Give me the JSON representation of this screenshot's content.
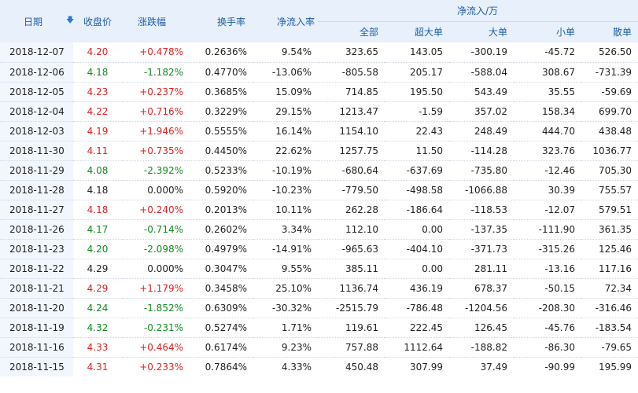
{
  "header": {
    "date": "日期",
    "close": "收盘价",
    "change": "涨跌幅",
    "turnover": "换手率",
    "net_rate": "净流入率",
    "group": "净流入/万",
    "all": "全部",
    "xl": "超大单",
    "l": "大单",
    "s": "小单",
    "r": "散单",
    "sort_icon": "arrow-down-icon"
  },
  "colors": {
    "up": "#e02222",
    "down": "#138a1f",
    "header_text": "#1f5ea8",
    "header_bg": "#e7f0fb"
  },
  "rows": [
    {
      "date": "2018-12-07",
      "close": "4.20",
      "change": "+0.478%",
      "turnover": "0.2636%",
      "rate": "9.54%",
      "all": "323.65",
      "xl": "143.05",
      "l": "-300.19",
      "s": "-45.72",
      "r": "526.50",
      "dir": "up"
    },
    {
      "date": "2018-12-06",
      "close": "4.18",
      "change": "-1.182%",
      "turnover": "0.4770%",
      "rate": "-13.06%",
      "all": "-805.58",
      "xl": "205.17",
      "l": "-588.04",
      "s": "308.67",
      "r": "-731.39",
      "dir": "down"
    },
    {
      "date": "2018-12-05",
      "close": "4.23",
      "change": "+0.237%",
      "turnover": "0.3685%",
      "rate": "15.09%",
      "all": "714.85",
      "xl": "195.50",
      "l": "543.49",
      "s": "35.55",
      "r": "-59.69",
      "dir": "up"
    },
    {
      "date": "2018-12-04",
      "close": "4.22",
      "change": "+0.716%",
      "turnover": "0.3229%",
      "rate": "29.15%",
      "all": "1213.47",
      "xl": "-1.59",
      "l": "357.02",
      "s": "158.34",
      "r": "699.70",
      "dir": "up"
    },
    {
      "date": "2018-12-03",
      "close": "4.19",
      "change": "+1.946%",
      "turnover": "0.5555%",
      "rate": "16.14%",
      "all": "1154.10",
      "xl": "22.43",
      "l": "248.49",
      "s": "444.70",
      "r": "438.48",
      "dir": "up"
    },
    {
      "date": "2018-11-30",
      "close": "4.11",
      "change": "+0.735%",
      "turnover": "0.4450%",
      "rate": "22.62%",
      "all": "1257.75",
      "xl": "11.50",
      "l": "-114.28",
      "s": "323.76",
      "r": "1036.77",
      "dir": "up"
    },
    {
      "date": "2018-11-29",
      "close": "4.08",
      "change": "-2.392%",
      "turnover": "0.5233%",
      "rate": "-10.19%",
      "all": "-680.64",
      "xl": "-637.69",
      "l": "-735.80",
      "s": "-12.46",
      "r": "705.30",
      "dir": "down"
    },
    {
      "date": "2018-11-28",
      "close": "4.18",
      "change": "0.000%",
      "turnover": "0.5920%",
      "rate": "-10.23%",
      "all": "-779.50",
      "xl": "-498.58",
      "l": "-1066.88",
      "s": "30.39",
      "r": "755.57",
      "dir": "flat"
    },
    {
      "date": "2018-11-27",
      "close": "4.18",
      "change": "+0.240%",
      "turnover": "0.2013%",
      "rate": "10.11%",
      "all": "262.28",
      "xl": "-186.64",
      "l": "-118.53",
      "s": "-12.07",
      "r": "579.51",
      "dir": "up"
    },
    {
      "date": "2018-11-26",
      "close": "4.17",
      "change": "-0.714%",
      "turnover": "0.2602%",
      "rate": "3.34%",
      "all": "112.10",
      "xl": "0.00",
      "l": "-137.35",
      "s": "-111.90",
      "r": "361.35",
      "dir": "down"
    },
    {
      "date": "2018-11-23",
      "close": "4.20",
      "change": "-2.098%",
      "turnover": "0.4979%",
      "rate": "-14.91%",
      "all": "-965.63",
      "xl": "-404.10",
      "l": "-371.73",
      "s": "-315.26",
      "r": "125.46",
      "dir": "down"
    },
    {
      "date": "2018-11-22",
      "close": "4.29",
      "change": "0.000%",
      "turnover": "0.3047%",
      "rate": "9.55%",
      "all": "385.11",
      "xl": "0.00",
      "l": "281.11",
      "s": "-13.16",
      "r": "117.16",
      "dir": "flat"
    },
    {
      "date": "2018-11-21",
      "close": "4.29",
      "change": "+1.179%",
      "turnover": "0.3458%",
      "rate": "25.10%",
      "all": "1136.74",
      "xl": "436.19",
      "l": "678.37",
      "s": "-50.15",
      "r": "72.34",
      "dir": "up"
    },
    {
      "date": "2018-11-20",
      "close": "4.24",
      "change": "-1.852%",
      "turnover": "0.6309%",
      "rate": "-30.32%",
      "all": "-2515.79",
      "xl": "-786.48",
      "l": "-1204.56",
      "s": "-208.30",
      "r": "-316.46",
      "dir": "down"
    },
    {
      "date": "2018-11-19",
      "close": "4.32",
      "change": "-0.231%",
      "turnover": "0.5274%",
      "rate": "1.71%",
      "all": "119.61",
      "xl": "222.45",
      "l": "126.45",
      "s": "-45.76",
      "r": "-183.54",
      "dir": "down"
    },
    {
      "date": "2018-11-16",
      "close": "4.33",
      "change": "+0.464%",
      "turnover": "0.6174%",
      "rate": "9.23%",
      "all": "757.88",
      "xl": "1112.64",
      "l": "-188.82",
      "s": "-86.30",
      "r": "-79.65",
      "dir": "up"
    },
    {
      "date": "2018-11-15",
      "close": "4.31",
      "change": "+0.233%",
      "turnover": "0.7864%",
      "rate": "4.33%",
      "all": "450.48",
      "xl": "307.99",
      "l": "37.49",
      "s": "-90.99",
      "r": "195.99",
      "dir": "up"
    }
  ]
}
